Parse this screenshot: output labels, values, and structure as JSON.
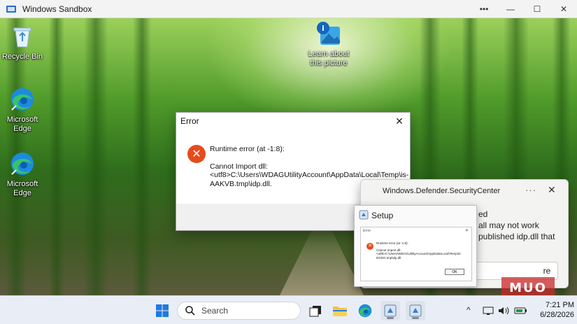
{
  "sandbox_window": {
    "title": "Windows Sandbox",
    "more_label": "•••",
    "minimize_label": "—",
    "maximize_label": "☐",
    "close_label": "✕"
  },
  "desktop_icons": [
    {
      "label": "Recycle Bin",
      "icon": "recycle-bin-icon"
    },
    {
      "label": "Microsoft Edge",
      "icon": "edge-icon"
    },
    {
      "label": "Microsoft Edge",
      "icon": "edge-icon"
    },
    {
      "label": "Learn about this picture",
      "icon": "learn-about-picture-icon"
    }
  ],
  "error_dialog": {
    "title": "Error",
    "close_label": "✕",
    "message_line1": "Runtime error (at -1:8):",
    "message_line2": "Cannot Import dll:<utf8>C:\\Users\\WDAGUtilityAccount\\AppData\\Local\\Temp\\is-AAKVB.tmp\\idp.dll."
  },
  "defender_toast": {
    "title": "Windows.Defender.SecurityCenter",
    "more_label": "···",
    "close_label": "✕",
    "line1": "ed",
    "line2": "all may not work",
    "line3": "published idp.dll that",
    "button_label": "re"
  },
  "setup_window": {
    "title": "Setup",
    "inner_title": "Error",
    "inner_close": "✕",
    "inner_line1": "Runtime error (at -1:8):",
    "inner_line2": "Cannot Import dll:<utf8>C:\\Users\\WDAGUtilityAccount\\AppData\\Local\\Temp\\is-DGDG.tmp\\idp.dll.",
    "ok_label": "OK"
  },
  "taskbar": {
    "search_placeholder": "Search",
    "apps": [
      "start-icon",
      "search-icon",
      "task-view-icon",
      "file-explorer-icon",
      "edge-icon",
      "setup-app-icon",
      "setup-app-icon"
    ],
    "tray_chevron": "^",
    "time": "7:21 PM",
    "date": "6/28/2026"
  },
  "watermark": "MUO"
}
